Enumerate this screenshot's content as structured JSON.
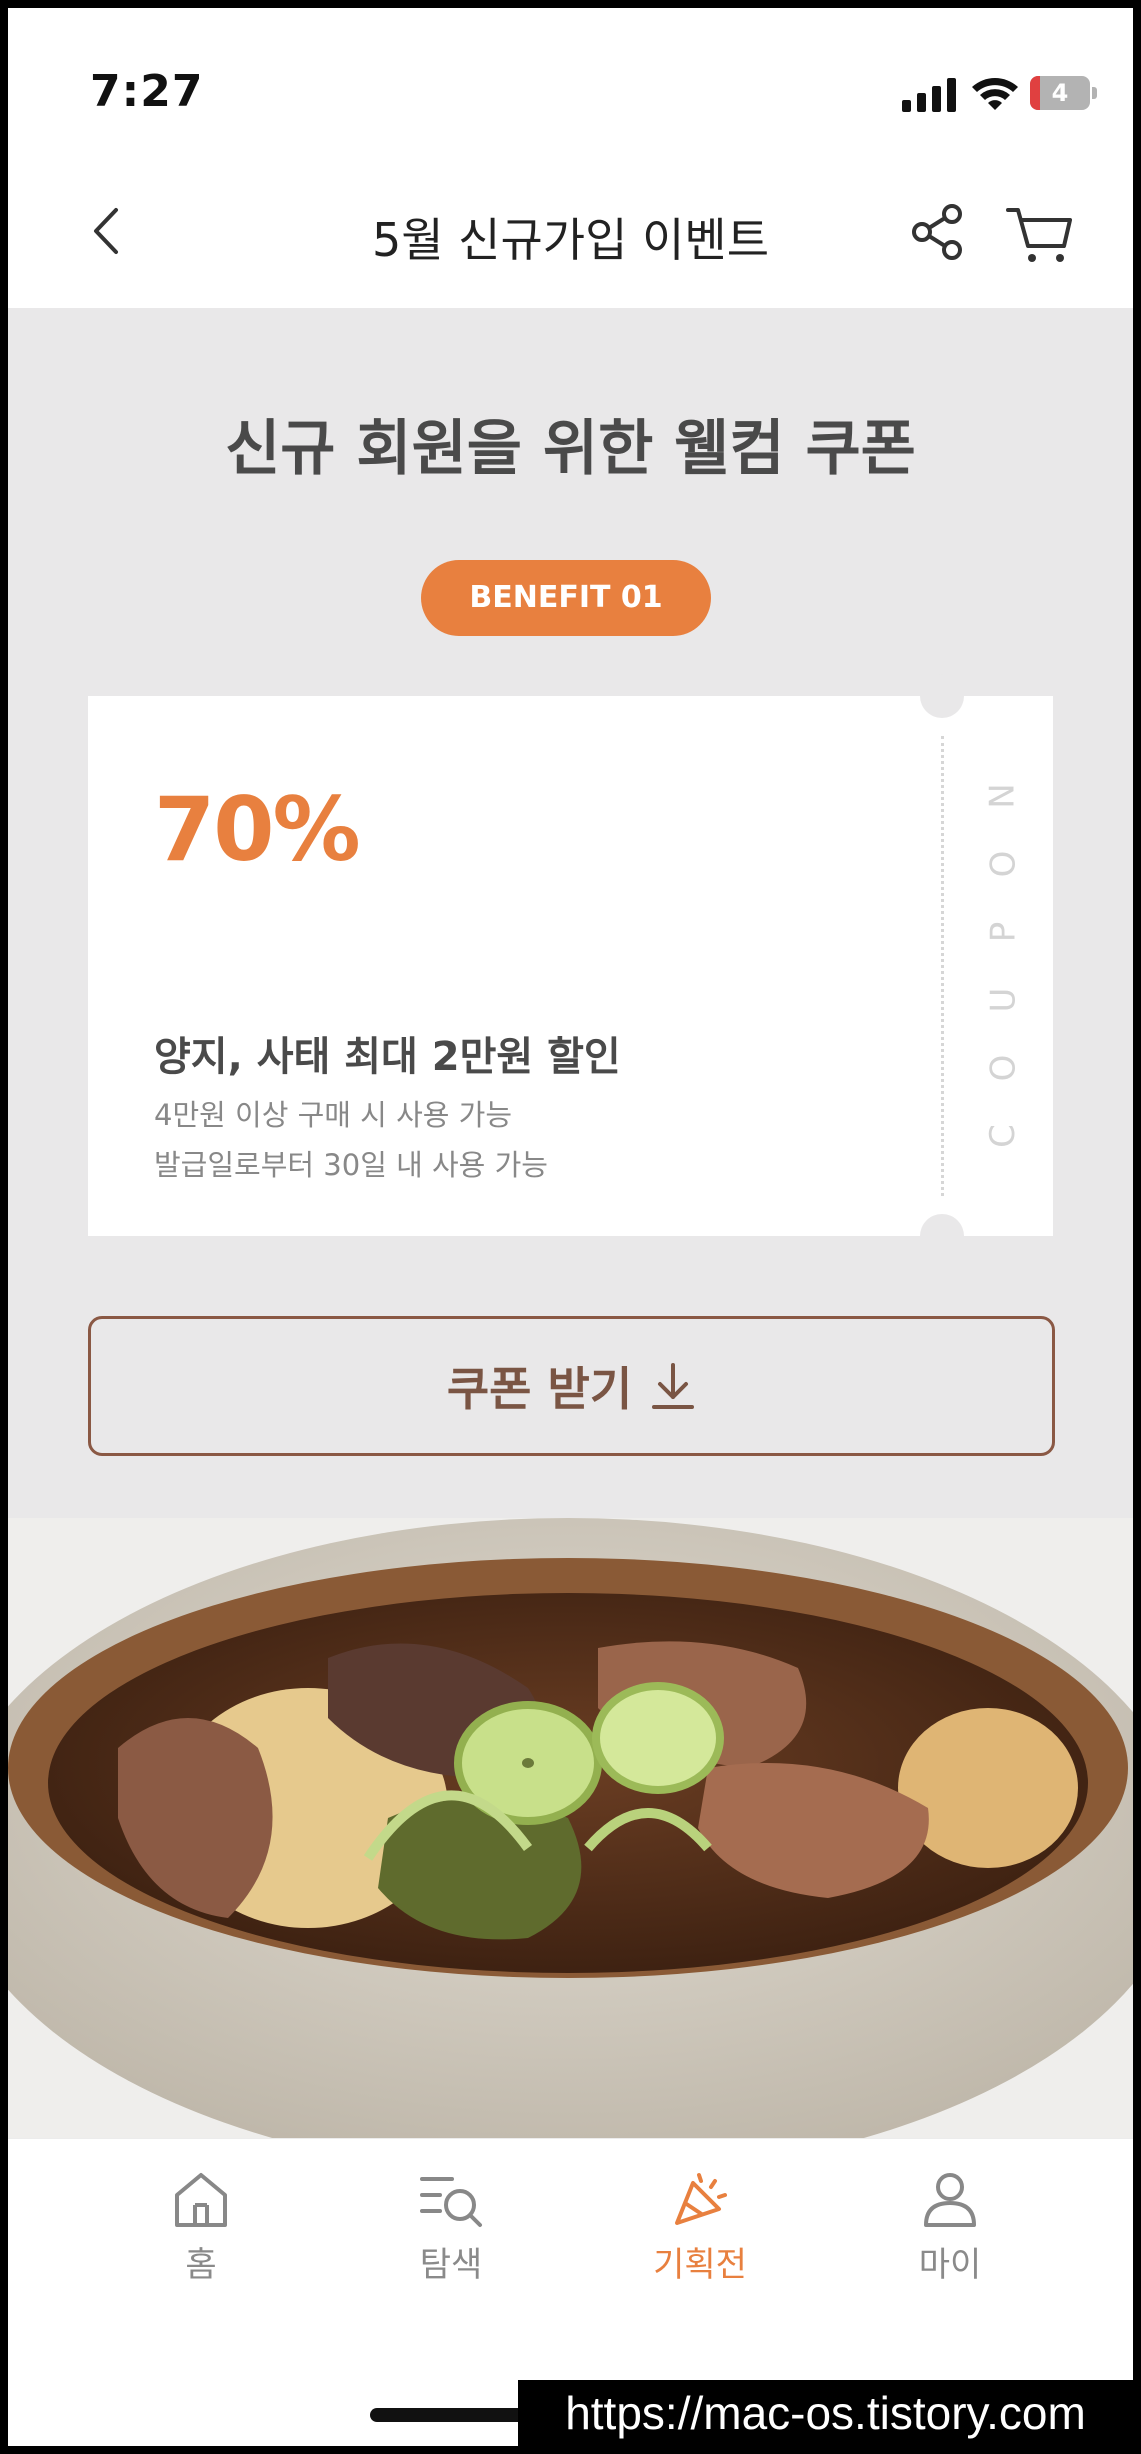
{
  "status_bar": {
    "time": "7:27",
    "battery_level": "4",
    "icons": [
      "signal-icon",
      "wifi-icon",
      "battery-icon"
    ]
  },
  "header": {
    "title": "5월 신규가입 이벤트",
    "icons": [
      "back-icon",
      "share-icon",
      "cart-icon"
    ]
  },
  "coupon_section": {
    "title": "신규 회원을 위한 웰컴 쿠폰",
    "benefit_label": "BENEFIT 01",
    "coupon": {
      "discount": "70%",
      "description": "양지, 사태 최대 2만원 할인",
      "condition_1": "4만원 이상 구매 시 사용 가능",
      "condition_2": "발급일로부터 30일 내 사용 가능",
      "side_letters": [
        "N",
        "O",
        "P",
        "U",
        "O",
        "C"
      ]
    },
    "get_coupon_label": "쿠폰 받기",
    "accent_color": "#e8803f",
    "button_border_color": "#8a5844"
  },
  "tab_bar": {
    "tabs": [
      {
        "label": "홈",
        "icon": "home-icon",
        "active": false
      },
      {
        "label": "탐색",
        "icon": "search-list-icon",
        "active": false
      },
      {
        "label": "기획전",
        "icon": "party-icon",
        "active": true
      },
      {
        "label": "마이",
        "icon": "person-icon",
        "active": false
      }
    ]
  },
  "watermark": "https://mac-os.tistory.com"
}
